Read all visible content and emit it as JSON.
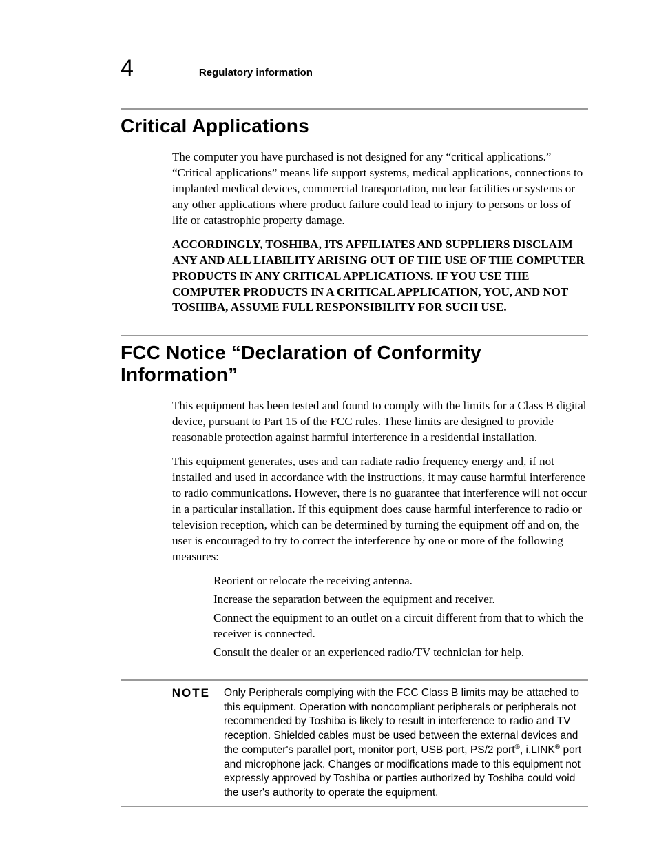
{
  "header": {
    "page_number": "4",
    "running_head": "Regulatory information"
  },
  "section1": {
    "title": "Critical Applications",
    "para1": "The computer you have purchased is not designed for any “critical applications.” “Critical applications” means life support systems, medical applications, connections to implanted medical devices, commercial transportation, nuclear facilities or systems or any other applications where product failure could lead to injury to persons or loss of life or catastrophic property damage.",
    "para2": "ACCORDINGLY, TOSHIBA, ITS AFFILIATES AND SUPPLIERS DISCLAIM ANY AND ALL LIABILITY ARISING OUT OF THE USE OF THE COMPUTER PRODUCTS IN ANY CRITICAL APPLICATIONS. IF YOU USE THE COMPUTER PRODUCTS IN A CRITICAL APPLICATION, YOU, AND NOT TOSHIBA, ASSUME FULL RESPONSIBILITY FOR SUCH USE."
  },
  "section2": {
    "title": "FCC Notice “Declaration of Conformity Information”",
    "para1": "This equipment has been tested and found to comply with the limits for a Class B digital device, pursuant to Part 15 of the FCC rules. These limits are designed to provide reasonable protection against harmful interference in a residential installation.",
    "para2": "This equipment generates, uses and can radiate radio frequency energy and, if not installed and used in accordance with the instructions, it may cause harmful interference to radio communications. However, there is no guarantee that interference will not occur in a particular installation. If this equipment does cause harmful interference to radio or television reception, which can be determined by turning the equipment off and on, the user is encouraged to try to correct the interference by one or more of the following measures:",
    "measures": [
      "Reorient or relocate the receiving antenna.",
      "Increase the separation between the equipment and receiver.",
      "Connect the equipment to an outlet on a circuit different from that to which the receiver is connected.",
      "Consult the dealer or an experienced radio/TV technician for help."
    ]
  },
  "note": {
    "label": "NOTE",
    "text_html": "Only Peripherals complying with the FCC Class B limits may be attached to this equipment. Operation with noncompliant peripherals or peripherals not recommended by Toshiba is likely to result in interference to radio and TV reception. Shielded cables must be used between the external devices and the computer's parallel port, monitor port, USB port, PS/2 port<sup>®</sup>, i.LINK<sup>®</sup> port and microphone jack. Changes or modifications made to this equipment not expressly approved by Toshiba or parties authorized by Toshiba could void the user's authority to operate the equipment."
  }
}
